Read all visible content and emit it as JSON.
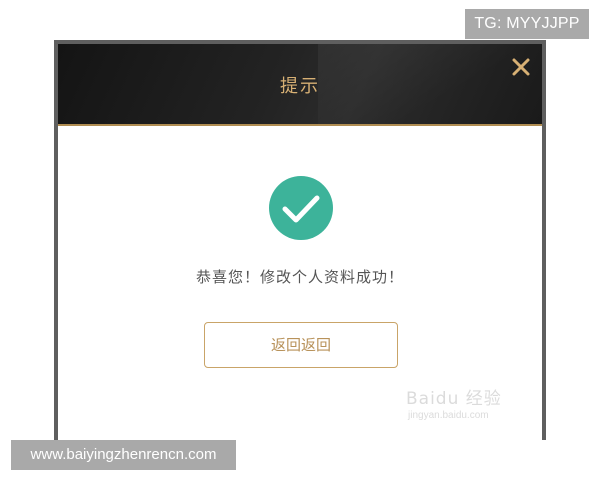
{
  "watermark_top": "TG: MYYJJPP",
  "watermark_bottom": "www.baiyingzhenrencn.com",
  "baidu_watermark": {
    "text": "Baidu 经验",
    "url": "jingyan.baidu.com"
  },
  "dialog": {
    "title": "提示",
    "close_icon": "close-icon",
    "success_icon": "checkmark-circle-icon",
    "message": "恭喜您！修改个人资料成功！",
    "button_label": "返回返回"
  },
  "colors": {
    "header_bg": "#1c1c1c",
    "title_gold": "#d7b074",
    "accent_gold": "#b08d52",
    "success_green": "#3db39a",
    "message_text": "#555555",
    "border_gray": "#5f5f5f"
  }
}
